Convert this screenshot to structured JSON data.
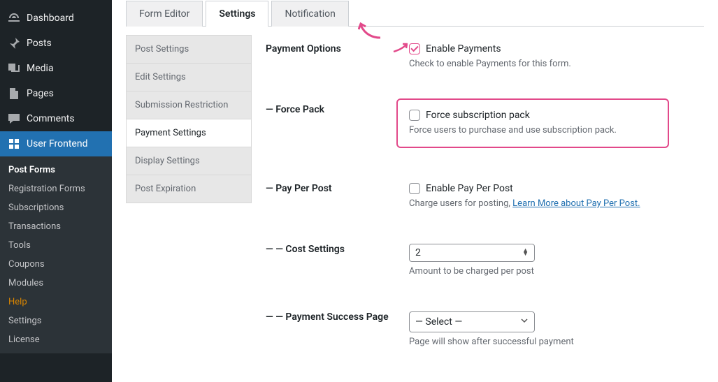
{
  "sidebar": {
    "items": [
      {
        "label": "Dashboard",
        "icon": "dashboard"
      },
      {
        "label": "Posts",
        "icon": "pin"
      },
      {
        "label": "Media",
        "icon": "media"
      },
      {
        "label": "Pages",
        "icon": "page"
      },
      {
        "label": "Comments",
        "icon": "comment"
      },
      {
        "label": "User Frontend",
        "icon": "user-frontend"
      }
    ],
    "sub_items": [
      {
        "label": "Post Forms",
        "active": true
      },
      {
        "label": "Registration Forms"
      },
      {
        "label": "Subscriptions"
      },
      {
        "label": "Transactions"
      },
      {
        "label": "Tools"
      },
      {
        "label": "Coupons"
      },
      {
        "label": "Modules"
      },
      {
        "label": "Help",
        "help": true
      },
      {
        "label": "Settings"
      },
      {
        "label": "License"
      }
    ]
  },
  "top_tabs": [
    {
      "label": "Form Editor"
    },
    {
      "label": "Settings",
      "active": true
    },
    {
      "label": "Notification"
    }
  ],
  "settings_list": [
    {
      "label": "Post Settings"
    },
    {
      "label": "Edit Settings"
    },
    {
      "label": "Submission Restriction"
    },
    {
      "label": "Payment Settings",
      "selected": true
    },
    {
      "label": "Display Settings"
    },
    {
      "label": "Post Expiration"
    }
  ],
  "fields": {
    "payment_options": {
      "label": "Payment Options",
      "enable_label": "Enable Payments",
      "enable_desc": "Check to enable Payments for this form.",
      "enable_checked": true
    },
    "force_pack": {
      "label": "— Force Pack",
      "chk_label": "Force subscription pack",
      "desc": "Force users to purchase and use subscription pack.",
      "checked": false
    },
    "pay_per_post": {
      "label": "— Pay Per Post",
      "chk_label": "Enable Pay Per Post",
      "desc_prefix": "Charge users for posting, ",
      "link_text": "Learn More about Pay Per Post.",
      "checked": false
    },
    "cost": {
      "label": "— — Cost Settings",
      "value": "2",
      "desc": "Amount to be charged per post"
    },
    "success_page": {
      "label": "— — Payment Success Page",
      "value": "— Select —",
      "desc": "Page will show after successful payment"
    }
  }
}
